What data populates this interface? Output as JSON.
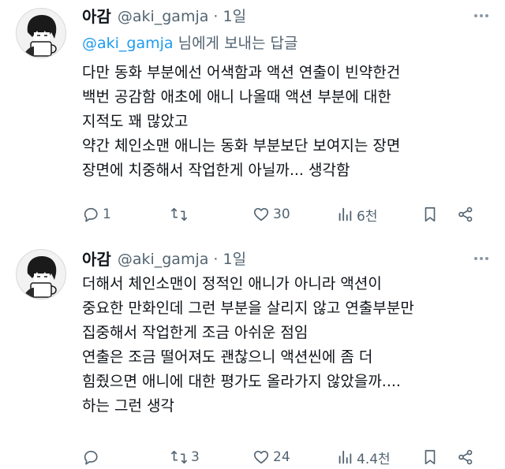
{
  "tweets": [
    {
      "name": "아감",
      "handle_line": "@aki_gamja · 1일",
      "reply_to": {
        "mention": "@aki_gamja",
        "suffix": " 님에게 보내는 답글"
      },
      "lines": [
        "다만 동화 부분에선 어색함과 액션 연출이 빈약한건",
        "백번 공감함 애초에 애니 나올때 액션 부분에 대한",
        "지적도 꽤 많았고",
        "약간 체인소맨 애니는 동화 부분보단 보여지는 장면",
        "장면에 치중해서 작업한게 아닐까... 생각함"
      ],
      "stats": {
        "replies": "1",
        "retweets": "",
        "likes": "30",
        "views": "6천"
      }
    },
    {
      "name": "아감",
      "handle_line": "@aki_gamja · 1일",
      "lines": [
        "더해서 체인소맨이 정적인 애니가 아니라 액션이",
        "중요한 만화인데 그런 부분을 살리지 않고 연출부분만",
        "집중해서 작업한게 조금 아쉬운 점임",
        "연출은 조금 떨어져도 괜찮으니 액션씬에 좀 더",
        "힘줬으면 애니에 대한 평가도 올라가지 않았을까....",
        "하는 그런 생각"
      ],
      "stats": {
        "replies": "",
        "retweets": "3",
        "likes": "24",
        "views": "4.4천"
      }
    }
  ],
  "icons": {
    "reply": "reply-icon",
    "retweet": "retweet-icon",
    "like": "heart-icon",
    "views": "views-icon",
    "bookmark": "bookmark-icon",
    "share": "share-icon",
    "more": "more-icon"
  },
  "colors": {
    "text": "#0f1419",
    "secondary": "#536471",
    "link": "#1d9bf0"
  }
}
